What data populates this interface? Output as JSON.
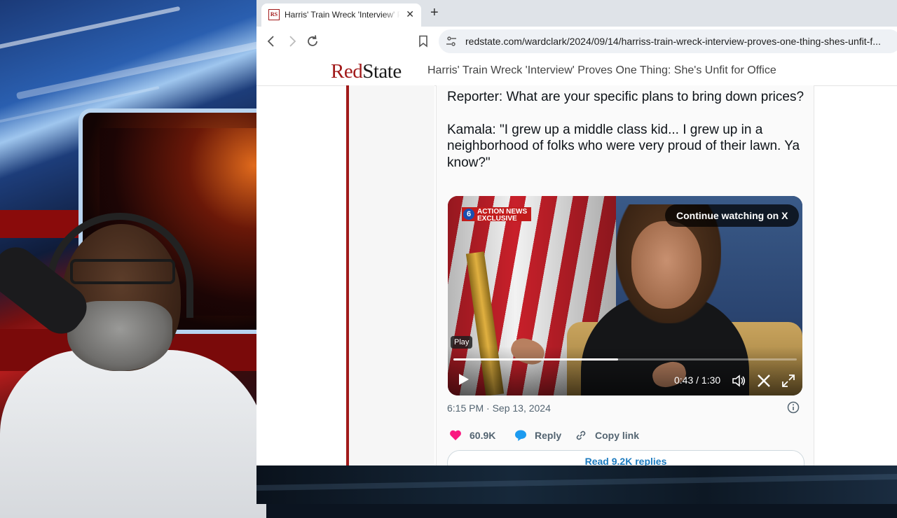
{
  "browser": {
    "tab_title": "Harris' Train Wreck 'Interview' Proves One Thing: She's Unfit for Office",
    "favicon_text": "RS",
    "new_tab_label": "+",
    "close_label": "✕",
    "url": "redstate.com/wardclark/2024/09/14/harriss-train-wreck-interview-proves-one-thing-shes-unfit-f..."
  },
  "site": {
    "logo_red": "Red",
    "logo_state": "State",
    "header_title": "Harris' Train Wreck 'Interview' Proves One Thing: She's Unfit for Office"
  },
  "tweet": {
    "paragraphs": [
      "Reporter: What are your specific plans to bring down prices?",
      "Kamala: \"I grew up a middle class kid... I grew up in a neighborhood of folks who were very proud of their lawn. Ya know?\""
    ],
    "video": {
      "badge_logo": "6",
      "badge_line1": "ACTION NEWS",
      "badge_line2": "EXCLUSIVE",
      "continue_label": "Continue watching on X",
      "play_tooltip": "Play",
      "time": "0:43 / 1:30",
      "progress": 0.48
    },
    "timestamp": "6:15 PM · Sep 13, 2024",
    "likes": "60.9K",
    "reply_label": "Reply",
    "copy_link_label": "Copy link",
    "read_replies": "Read 9.2K replies"
  },
  "colors": {
    "brand_red": "#a11a1a",
    "like_pink": "#f91880",
    "reply_blue": "#1d9bf0",
    "link_blue": "#1d7bbf"
  },
  "icons": {
    "back": "arrow-left-icon",
    "forward": "arrow-right-icon",
    "reload": "reload-icon",
    "bookmark": "bookmark-icon",
    "site_info": "tune-icon",
    "play": "play-icon",
    "mute": "volume-icon",
    "x_logo": "x-logo-icon",
    "fullscreen": "fullscreen-icon",
    "info": "info-icon",
    "heart": "heart-icon",
    "reply": "speech-bubble-icon",
    "link": "link-icon"
  }
}
